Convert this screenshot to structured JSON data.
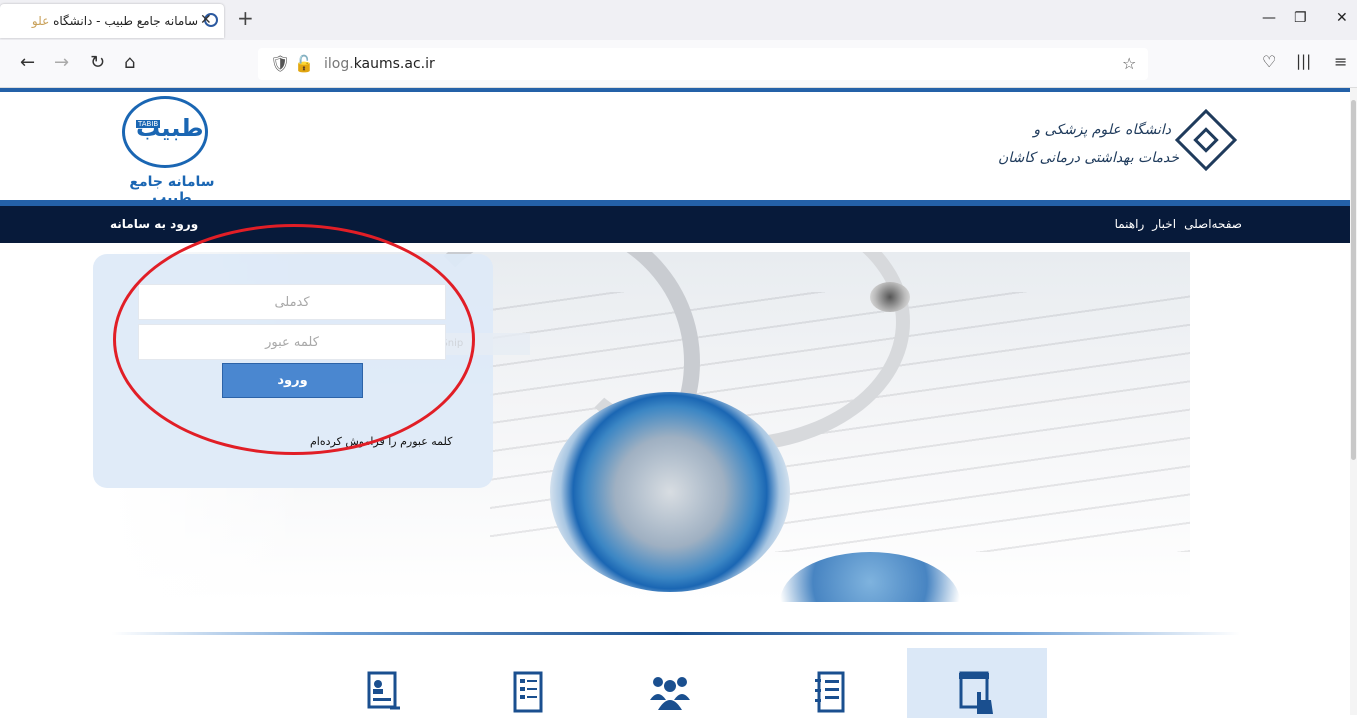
{
  "browser": {
    "tab_title": "سامانه جامع طبیب - دانشگاه",
    "tab_title_faded": "علو",
    "url_host_dim": "ilog.",
    "url_host": "kaums.ac.ir",
    "icons": [
      "back-arrow-icon",
      "forward-arrow-icon",
      "reload-icon",
      "home-icon",
      "shield-icon",
      "lock-off-icon",
      "star-icon",
      "pocket-icon",
      "library-icon",
      "menu-icon"
    ]
  },
  "header": {
    "tabib_logo_word": "طبیب",
    "tabib_logo_latin": "TABIB",
    "tabib_caption": "سامانه جامع طبیب",
    "uni_line1": "دانشگاه علوم پزشکی و",
    "uni_line2": "خدمات بهداشتی درمانی کاشان"
  },
  "nav": {
    "login": "ورود به سامانه",
    "links": [
      "صفحه‌اصلی",
      "اخبار",
      "راهنما"
    ]
  },
  "login": {
    "national_id_placeholder": "کدملی",
    "password_placeholder": "کلمه عبور",
    "submit_label": "ورود",
    "forgot_label": "کلمه عبورم را فراموش کرده‌ام",
    "snip_hint": "Rectangular Snip"
  },
  "features": [
    "contact-card-icon",
    "checklist-icon",
    "users-group-icon",
    "notebook-icon",
    "touch-form-icon"
  ]
}
